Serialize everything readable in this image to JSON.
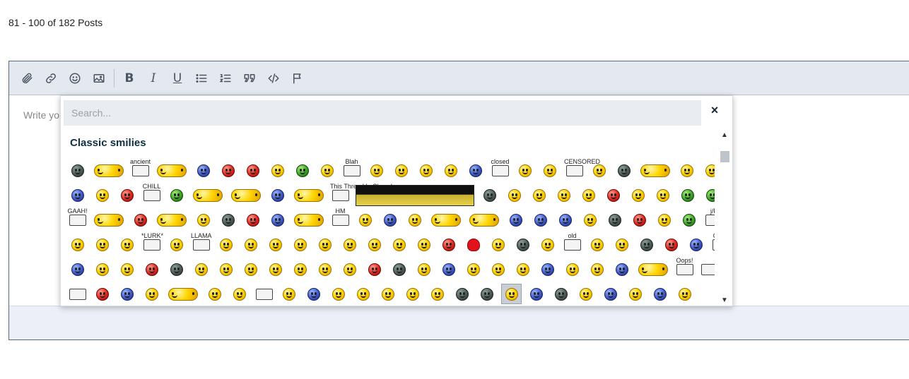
{
  "pagination": {
    "text": "81 - 100 of 182 Posts"
  },
  "toolbar": {
    "buttons": [
      {
        "name": "attach",
        "icon": "paperclip-icon"
      },
      {
        "name": "link",
        "icon": "link-icon"
      },
      {
        "name": "emoji",
        "icon": "smiley-icon"
      },
      {
        "name": "image",
        "icon": "image-icon"
      },
      {
        "name": "bold",
        "label": "B"
      },
      {
        "name": "italic",
        "label": "I"
      },
      {
        "name": "underline",
        "label": "U"
      },
      {
        "name": "bullet-list",
        "icon": "bullet-list-icon"
      },
      {
        "name": "numbered-list",
        "icon": "numbered-list-icon"
      },
      {
        "name": "quote",
        "icon": "quote-icon"
      },
      {
        "name": "code",
        "icon": "code-icon"
      },
      {
        "name": "flag",
        "icon": "flag-icon"
      }
    ],
    "bold_label": "B",
    "italic_label": "I",
    "underline_label": "U"
  },
  "editor": {
    "placeholder_visible": "Write yo"
  },
  "picker": {
    "search_placeholder": "Search...",
    "close_label": "×",
    "category_title": "Classic smilies",
    "scroll_up": "▲",
    "scroll_down": "▼",
    "smilie_labels": {
      "ancient": "ancient",
      "blah": "Blah",
      "closed": "closed",
      "censored": "CENSORED",
      "chill": "CHILL",
      "gaah": "GAAH!",
      "hm": "HM",
      "jk": "j/k",
      "lurk": "*LURK*",
      "llama": "LLAMA",
      "old": "old",
      "omg": "OMG",
      "oops": "Oops!",
      "thread_is_closed": "This Thread Is Closed"
    },
    "rows": [
      [
        "dark",
        "wide",
        "sign",
        "wide",
        "blue",
        "red",
        "red",
        "plain",
        "green",
        "plain",
        "sign",
        "plain",
        "plain",
        "plain",
        "plain",
        "blue",
        "sign",
        "plain",
        "plain",
        "sign",
        "plain",
        "dark",
        "wide",
        "plain",
        "plain",
        "wide"
      ],
      [
        "blue",
        "plain",
        "red",
        "sign",
        "green",
        "wide",
        "wide",
        "blue",
        "wide",
        "sign",
        "banner",
        "dark",
        "plain",
        "plain",
        "plain",
        "plain",
        "red",
        "plain",
        "plain",
        "green",
        "green"
      ],
      [
        "sign",
        "wide",
        "red",
        "wide",
        "plain",
        "dark",
        "red",
        "blue",
        "wide",
        "sign",
        "plain",
        "blue",
        "plain",
        "wide",
        "wide",
        "blue",
        "blue",
        "blue",
        "plain",
        "dark",
        "red",
        "plain",
        "green",
        "sign",
        "blue"
      ],
      [
        "plain",
        "plain",
        "plain",
        "sign",
        "plain",
        "sign",
        "plain",
        "plain",
        "plain",
        "plain",
        "plain",
        "plain",
        "plain",
        "plain",
        "plain",
        "red",
        "heart",
        "plain",
        "dark",
        "plain",
        "sign",
        "plain",
        "plain",
        "dark",
        "red",
        "blue",
        "sign"
      ],
      [
        "blue",
        "plain",
        "plain",
        "red",
        "dark",
        "plain",
        "plain",
        "plain",
        "plain",
        "plain",
        "plain",
        "plain",
        "red",
        "dark",
        "plain",
        "blue",
        "plain",
        "plain",
        "plain",
        "blue",
        "plain",
        "plain",
        "blue",
        "wide",
        "sign",
        "sign"
      ],
      [
        "sign",
        "red",
        "blue",
        "plain",
        "wide",
        "plain",
        "plain",
        "sign",
        "plain",
        "blue",
        "plain",
        "plain",
        "plain",
        "plain",
        "plain",
        "dark",
        "dark",
        "selected",
        "blue",
        "dark",
        "plain",
        "blue",
        "plain",
        "blue",
        "plain"
      ]
    ]
  }
}
